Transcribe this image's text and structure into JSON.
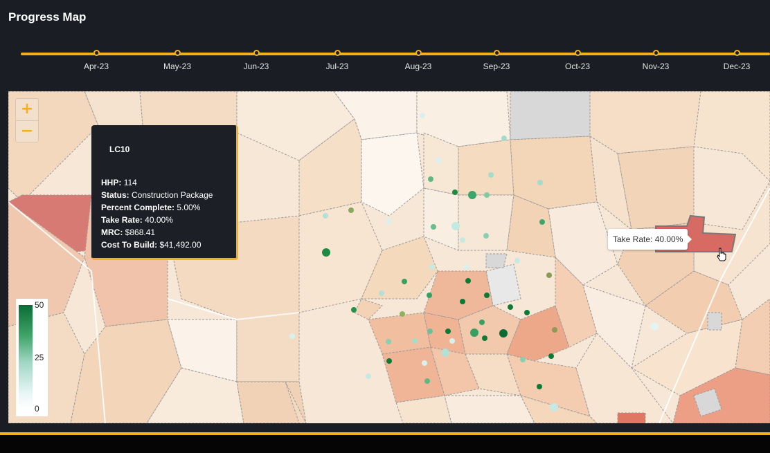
{
  "header": {
    "title": "Progress Map"
  },
  "timeline": {
    "months": [
      "Apr-23",
      "May-23",
      "Jun-23",
      "Jul-23",
      "Aug-23",
      "Sep-23",
      "Oct-23",
      "Nov-23",
      "Dec-23"
    ]
  },
  "map": {
    "zoom_in": "+",
    "zoom_out": "−"
  },
  "info_panel": {
    "name": "LC10",
    "hhp_label": "HHP:",
    "hhp_value": "114",
    "status_label": "Status:",
    "status_value": "Construction Package",
    "percent_label": "Percent Complete:",
    "percent_value": "5.00%",
    "take_label": "Take Rate:",
    "take_value": "40.00%",
    "mrc_label": "MRC:",
    "mrc_value": "$868.41",
    "cost_label": "Cost To Build:",
    "cost_value": "$41,492.00"
  },
  "tooltip": {
    "text": "Take Rate: 40.00%"
  },
  "legend": {
    "max": "50",
    "mid": "25",
    "min": "0"
  },
  "colors": {
    "accent": "#f2b01e",
    "background": "#1a1d23",
    "highlight": "#d86a64"
  }
}
